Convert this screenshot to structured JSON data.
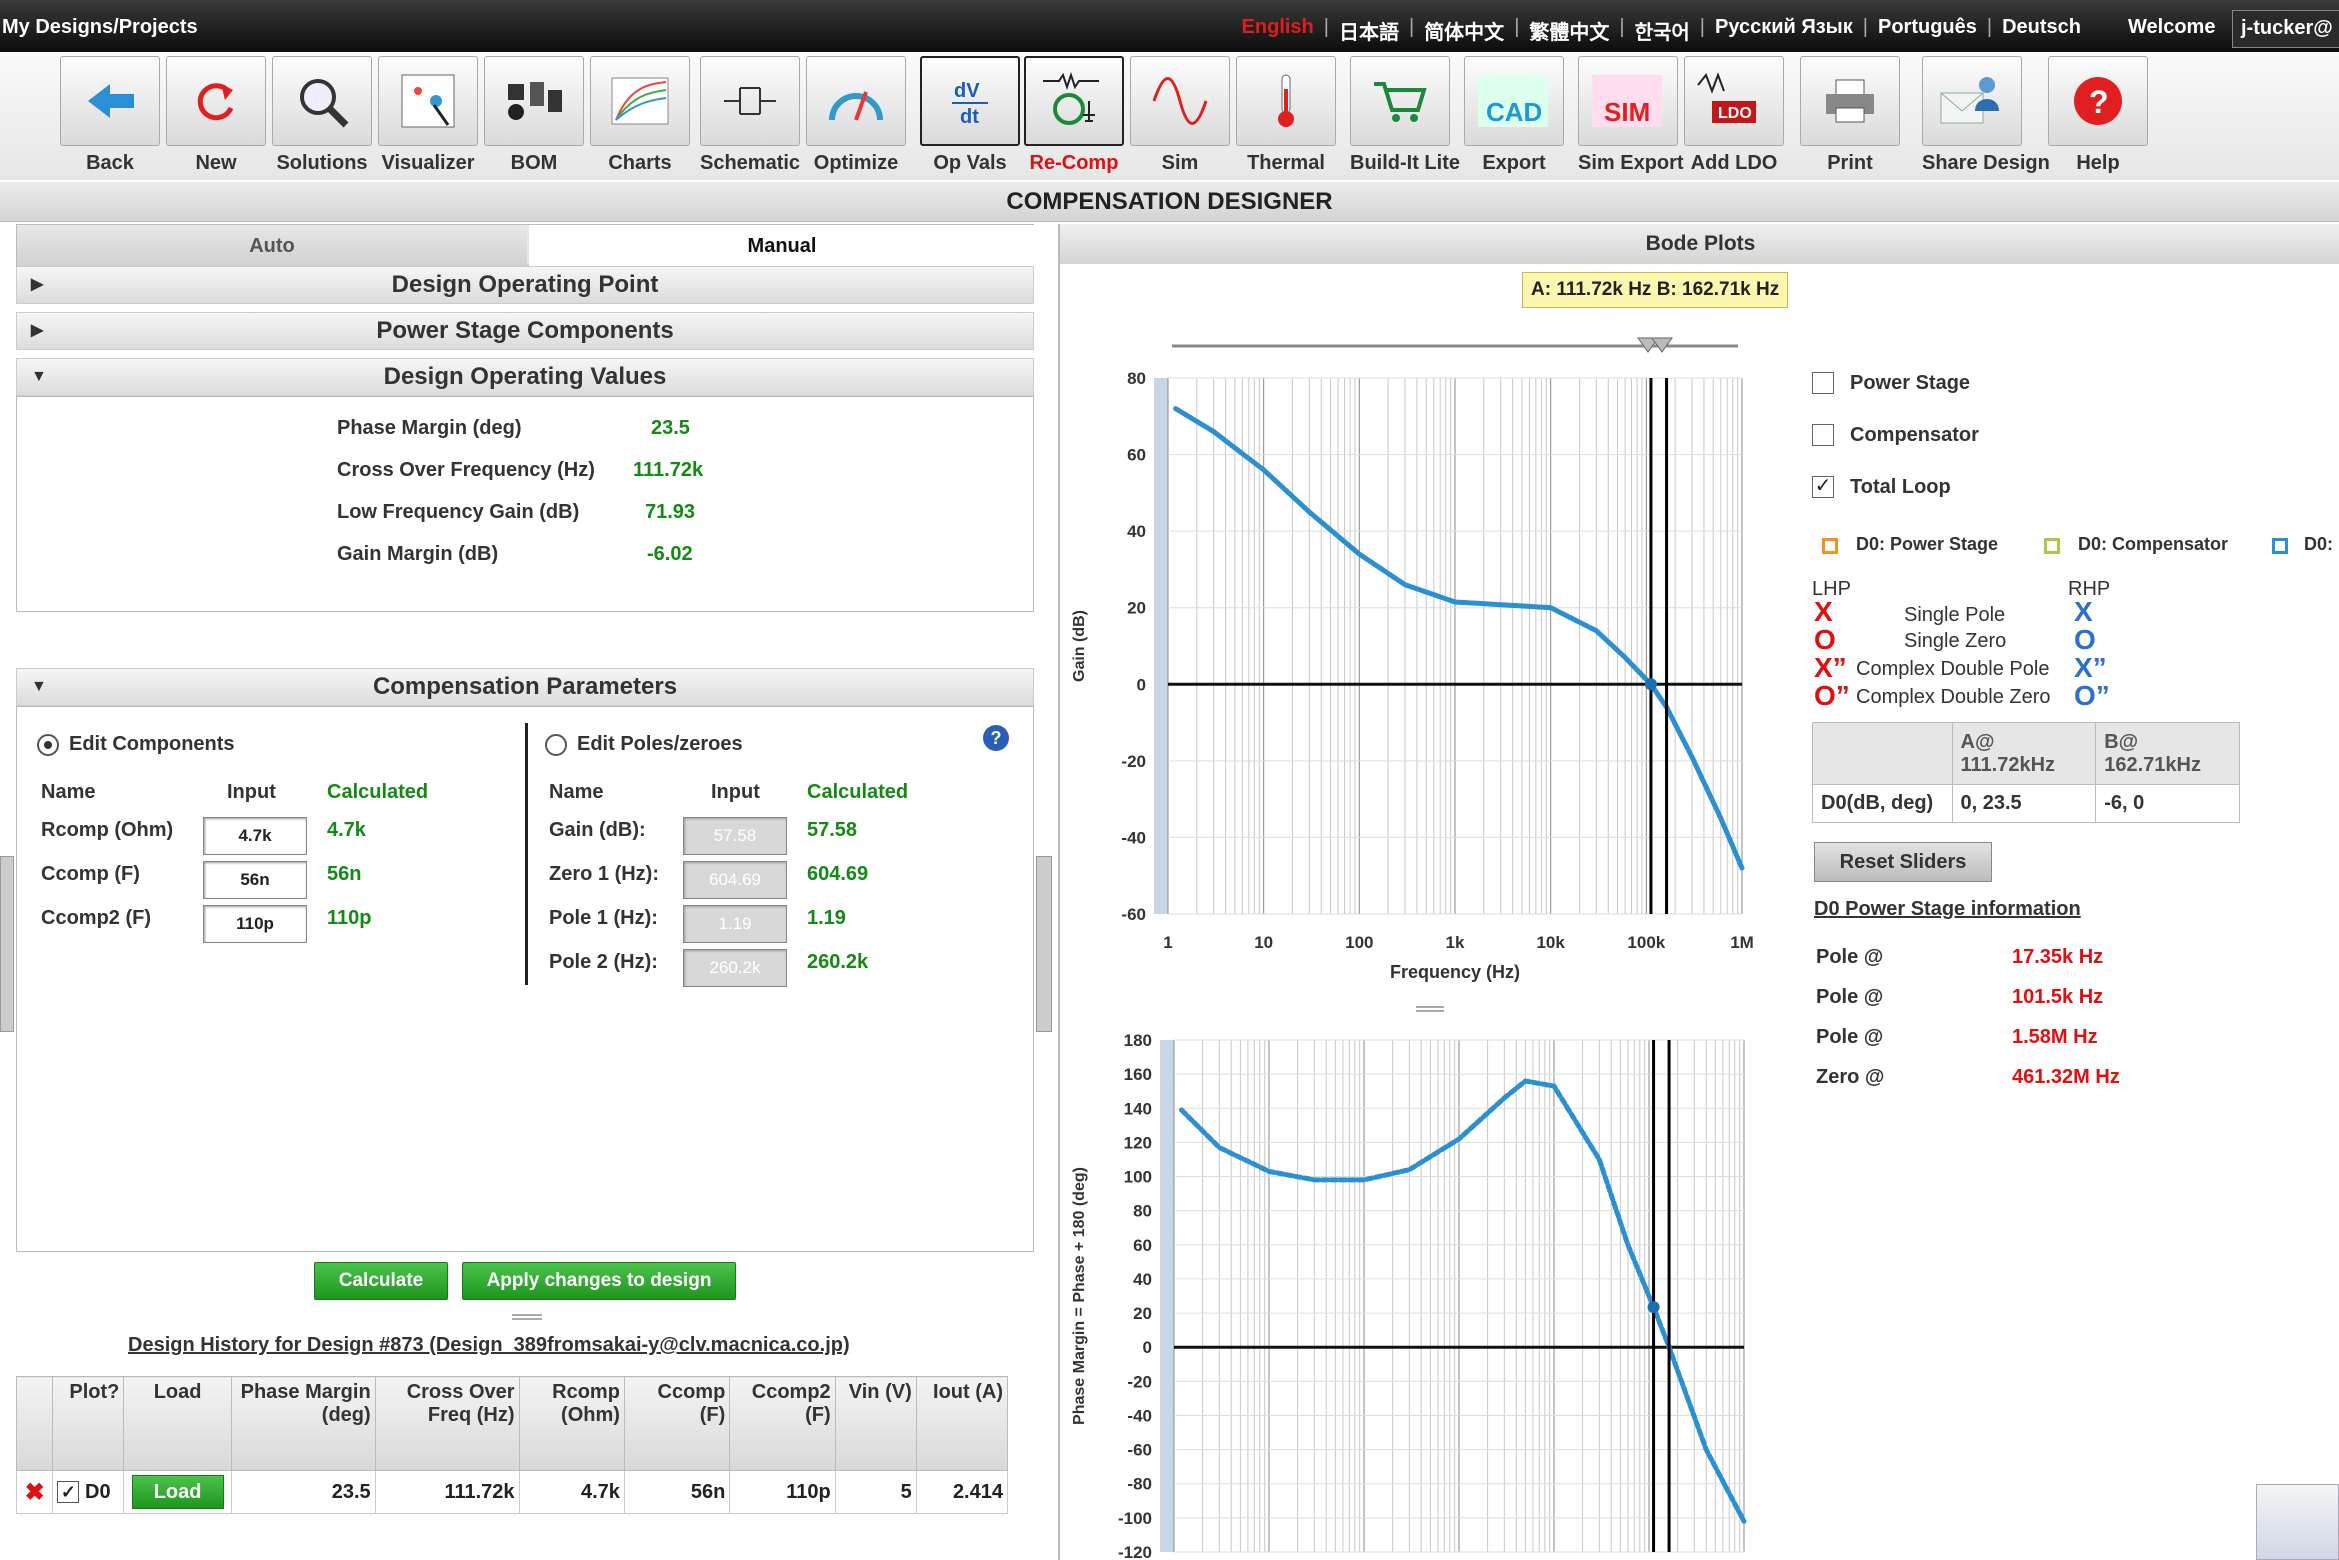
{
  "header": {
    "brand": "My Designs/Projects",
    "languages": [
      "English",
      "日本語",
      "简体中文",
      "繁體中文",
      "한국어",
      "Русский Язык",
      "Português",
      "Deutsch"
    ],
    "welcome": "Welcome",
    "user": "j-tucker@"
  },
  "toolbar": [
    {
      "label": "Back",
      "icon": "back-arrow-icon"
    },
    {
      "label": "New",
      "icon": "refresh-icon"
    },
    {
      "label": "Solutions",
      "icon": "magnifier-icon"
    },
    {
      "label": "Visualizer",
      "icon": "visualizer-icon"
    },
    {
      "label": "BOM",
      "icon": "chip-icon"
    },
    {
      "label": "Charts",
      "icon": "chart-icon"
    },
    {
      "label": "Schematic",
      "icon": "schematic-icon"
    },
    {
      "label": "Optimize",
      "icon": "dial-icon"
    },
    {
      "label": "Op Vals",
      "icon": "dvdt-icon"
    },
    {
      "label": "Re-Comp",
      "icon": "recomp-icon"
    },
    {
      "label": "Sim",
      "icon": "sine-wave-icon"
    },
    {
      "label": "Thermal",
      "icon": "thermometer-icon"
    },
    {
      "label": "Build-It Lite",
      "icon": "cart-icon"
    },
    {
      "label": "Export",
      "icon": "cad-icon"
    },
    {
      "label": "Sim Export",
      "icon": "sim-icon"
    },
    {
      "label": "Add LDO",
      "icon": "ldo-icon"
    },
    {
      "label": "Print",
      "icon": "printer-icon"
    },
    {
      "label": "Share Design",
      "icon": "share-icon"
    },
    {
      "label": "Help",
      "icon": "help-icon"
    }
  ],
  "page_title": "COMPENSATION DESIGNER",
  "tabs": {
    "auto": "Auto",
    "manual": "Manual"
  },
  "sections": {
    "dop": "Design Operating Point",
    "psc": "Power Stage Components",
    "dov": "Design Operating Values",
    "cp": "Compensation Parameters"
  },
  "operating_values": [
    {
      "label": "Phase Margin (deg)",
      "value": "23.5"
    },
    {
      "label": "Cross Over Frequency (Hz)",
      "value": "111.72k"
    },
    {
      "label": "Low Frequency Gain (dB)",
      "value": "71.93"
    },
    {
      "label": "Gain Margin (dB)",
      "value": "-6.02"
    }
  ],
  "comp": {
    "edit_components": "Edit Components",
    "edit_poles": "Edit Poles/zeroes",
    "col_name": "Name",
    "col_input": "Input",
    "col_calc": "Calculated",
    "components": [
      {
        "name": "Rcomp (Ohm)",
        "input": "4.7k",
        "calc": "4.7k"
      },
      {
        "name": "Ccomp (F)",
        "input": "56n",
        "calc": "56n"
      },
      {
        "name": "Ccomp2 (F)",
        "input": "110p",
        "calc": "110p"
      }
    ],
    "poles": [
      {
        "name": "Gain (dB):",
        "input": "57.58",
        "calc": "57.58"
      },
      {
        "name": "Zero 1 (Hz):",
        "input": "604.69",
        "calc": "604.69"
      },
      {
        "name": "Pole 1 (Hz):",
        "input": "1.19",
        "calc": "1.19"
      },
      {
        "name": "Pole 2 (Hz):",
        "input": "260.2k",
        "calc": "260.2k"
      }
    ]
  },
  "buttons": {
    "calculate": "Calculate",
    "apply": "Apply changes to design",
    "reset": "Reset Sliders",
    "load": "Load"
  },
  "history": {
    "title": "Design History for Design #873 (Design_389fromsakai-y@clv.macnica.co.jp)",
    "headers": [
      "Plot?",
      "Load",
      "Phase Margin (deg)",
      "Cross Over Freq (Hz)",
      "Rcomp (Ohm)",
      "Ccomp (F)",
      "Ccomp2 (F)",
      "Vin (V)",
      "Iout (A)"
    ],
    "row": {
      "name": "D0",
      "pm": "23.5",
      "fc": "111.72k",
      "rcomp": "4.7k",
      "ccomp": "56n",
      "ccomp2": "110p",
      "vin": "5",
      "iout": "2.414"
    }
  },
  "bode": {
    "title": "Bode Plots",
    "marker": "A: 111.72k Hz B: 162.71k Hz",
    "gain_ylabel": "Gain (dB)",
    "phase_ylabel": "Phase Margin = Phase + 180 (deg)",
    "xlabel": "Frequency (Hz)",
    "xticks": [
      "1",
      "10",
      "100",
      "1k",
      "10k",
      "100k",
      "1M"
    ],
    "gain_yticks": [
      "80",
      "60",
      "40",
      "20",
      "0",
      "-20",
      "-40",
      "-60"
    ],
    "phase_yticks": [
      "180",
      "160",
      "140",
      "120",
      "100",
      "80",
      "60",
      "40",
      "20",
      "0",
      "-20",
      "-40",
      "-60",
      "-80",
      "-100",
      "-120"
    ]
  },
  "legend": {
    "power_stage": "Power Stage",
    "compensator": "Compensator",
    "total_loop": "Total Loop",
    "d0_ps": "D0: Power Stage",
    "d0_comp": "D0: Compensator",
    "d0": "D0:"
  },
  "pz": {
    "lhp": "LHP",
    "rhp": "RHP",
    "single_pole": "Single Pole",
    "single_zero": "Single Zero",
    "cdp": "Complex Double Pole",
    "cdz": "Complex Double Zero",
    "x": "X",
    "o": "O",
    "xx": "X”",
    "oo": "O”"
  },
  "cursor_table": {
    "a": "A@ 111.72kHz",
    "b": "B@ 162.71kHz",
    "row_label": "D0(dB, deg)",
    "a_val": "0, 23.5",
    "b_val": "-6, 0"
  },
  "ps_info": {
    "title": "D0 Power Stage information",
    "items": [
      {
        "k": "Pole @",
        "v": "17.35k Hz"
      },
      {
        "k": "Pole @",
        "v": "101.5k Hz"
      },
      {
        "k": "Pole @",
        "v": "1.58M Hz"
      },
      {
        "k": "Zero @",
        "v": "461.32M Hz"
      }
    ]
  },
  "colors": {
    "accent_red": "#e01010",
    "green": "#138a13",
    "curve": "#2b8fd0"
  }
}
